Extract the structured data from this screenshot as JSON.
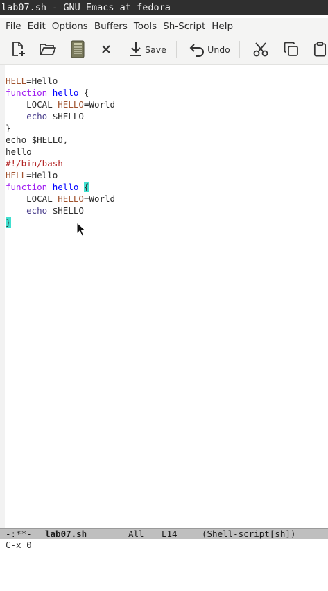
{
  "window": {
    "title": "lab07.sh - GNU Emacs at fedora"
  },
  "menubar": {
    "items": [
      "File",
      "Edit",
      "Options",
      "Buffers",
      "Tools",
      "Sh-Script",
      "Help"
    ]
  },
  "toolbar": {
    "new_icon": "new-file-icon",
    "open_icon": "open-folder-icon",
    "save_buffer_icon": "save-disk-icon",
    "close_icon": "close-icon",
    "save_label": "Save",
    "undo_label": "Undo",
    "cut_icon": "scissors-icon",
    "copy_icon": "copy-icon",
    "paste_icon": "paste-icon"
  },
  "editor": {
    "lines": [
      "HELL=Hello",
      "function hello {",
      "    LOCAL HELLO=World",
      "    echo $HELLO",
      "}",
      "echo $HELLO,",
      "hello",
      "#!/bin/bash",
      "HELL=Hello",
      "function hello {",
      "    LOCAL HELLO=World",
      "    echo $HELLO",
      "}"
    ]
  },
  "modeline": {
    "status": "-:**-",
    "buffer_name": "lab07.sh",
    "position": "All",
    "line": "L14",
    "mode": "(Shell-script[sh])"
  },
  "minibuffer": {
    "text": "C-x 0"
  },
  "colors": {
    "titlebar_bg": "#2f2f2f",
    "variable": "#a0522d",
    "keyword": "#a020f0",
    "function_name": "#0000ff",
    "builtin": "#483d8b",
    "comment": "#b22222",
    "paren_match": "#40e0d0",
    "modeline_bg": "#bfbfbf"
  }
}
